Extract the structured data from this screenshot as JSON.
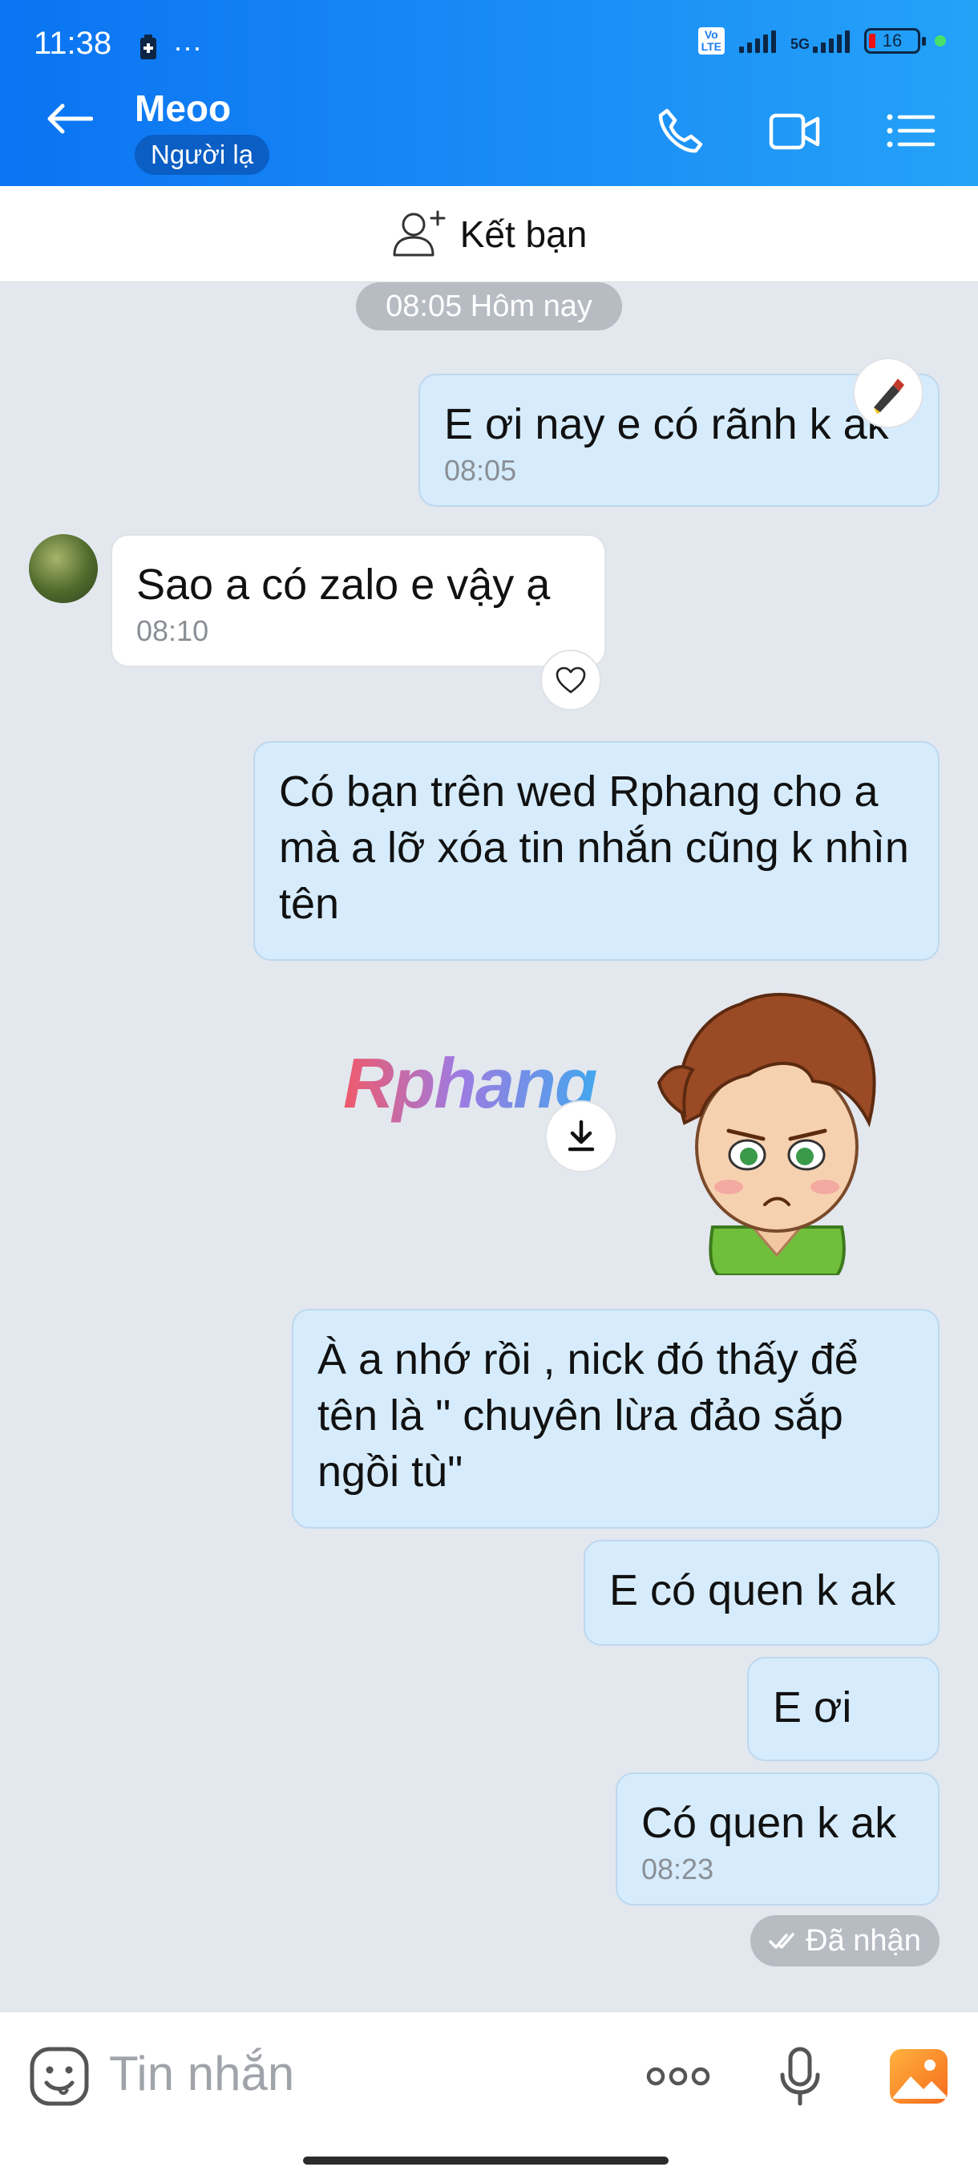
{
  "status_bar": {
    "time": "11:38",
    "more": "···",
    "network": "5G",
    "battery": "16"
  },
  "header": {
    "contact_name": "Meoo",
    "badge": "Người lạ",
    "icons": [
      "back-arrow-icon",
      "phone-icon",
      "video-icon",
      "list-menu-icon"
    ]
  },
  "add_friend": {
    "label": "Kết bạn"
  },
  "chat": {
    "date_chip": "08:05 Hôm nay",
    "messages": [
      {
        "side": "me",
        "text": "E ơi nay e có rãnh k ak",
        "time": "08:05"
      },
      {
        "side": "them",
        "text": "Sao a có zalo e vậy ạ",
        "time": "08:10"
      },
      {
        "side": "me",
        "text": "Có bạn trên wed Rphang cho a mà a lỡ xóa tin nhắn cũng k nhìn tên"
      },
      {
        "side": "me",
        "text": "À a nhớ rồi , nick đó thấy để tên là \" chuyên lừa đảo sắp ngồi tù\""
      },
      {
        "side": "me",
        "text": "E có quen k ak"
      },
      {
        "side": "me",
        "text": "E ơi"
      },
      {
        "side": "me",
        "text": "Có quen k ak",
        "time": "08:23"
      }
    ],
    "sticker_watermark": "Rphang",
    "delivery_status": "Đã nhận"
  },
  "input_bar": {
    "placeholder": "Tin nhắn"
  },
  "colors": {
    "header_start": "#0a74f2",
    "header_end": "#24a2f8",
    "my_bubble": "#d6ecfd",
    "chat_bg": "#e3e7ee"
  }
}
